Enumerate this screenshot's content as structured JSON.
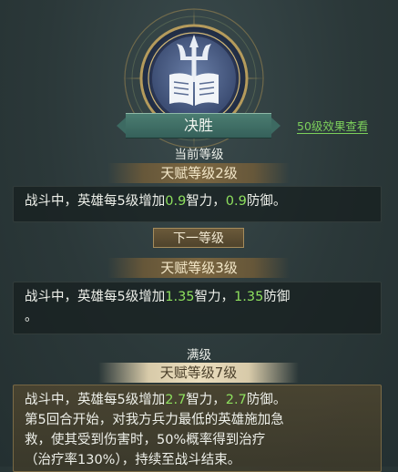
{
  "talent": {
    "name": "决胜",
    "link_50": "50级效果查看"
  },
  "current": {
    "heading": "当前等级",
    "tier": "天赋等级2级",
    "desc": {
      "p1": "战斗中，英雄每5级增加",
      "v1": "0.9",
      "p2": "智力，",
      "v2": "0.9",
      "p3": "防御。"
    }
  },
  "next": {
    "heading": "下一等级",
    "tier": "天赋等级3级",
    "desc": {
      "p1": "战斗中，英雄每5级增加",
      "v1": "1.35",
      "p2": "智力，",
      "v2": "1.35",
      "p3": "防御",
      "p4": "。"
    }
  },
  "max": {
    "heading": "满级",
    "tier": "天赋等级7级",
    "desc": {
      "p1": "战斗中，英雄每5级增加",
      "v1": "2.7",
      "p2": "智力，",
      "v2": "2.7",
      "p3": "防御。",
      "line2": "第5回合开始，对我方兵力最低的英雄施加急",
      "line3": "救，使其受到伤害时，50%概率得到治疗",
      "line4": "（治疗率130%），持续至战斗结束。"
    }
  },
  "colors": {
    "value_green": "#8ee05e",
    "link_green": "#7ccf5b",
    "plate_teal": "#4b7d71"
  },
  "icons": {
    "emblem": "trident-book-emblem-icon"
  }
}
